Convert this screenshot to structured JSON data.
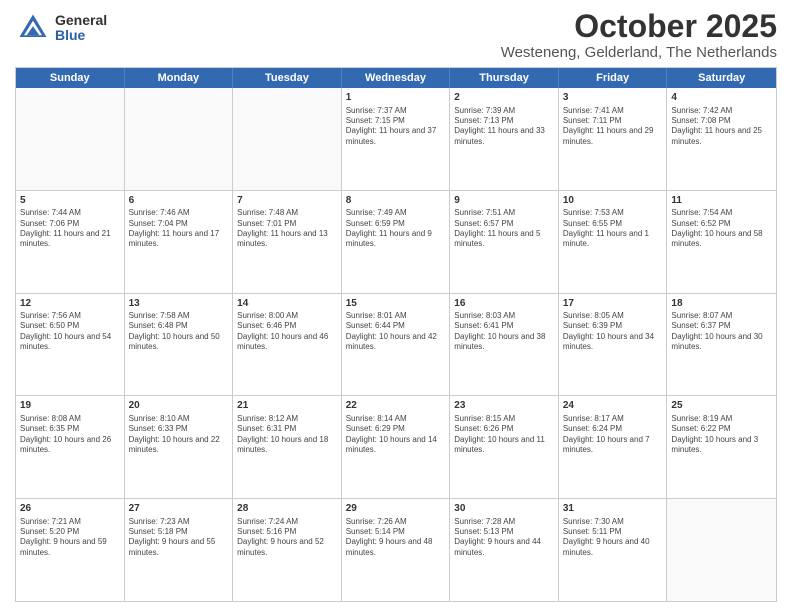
{
  "logo": {
    "general": "General",
    "blue": "Blue"
  },
  "title": "October 2025",
  "location": "Westeneng, Gelderland, The Netherlands",
  "days": [
    "Sunday",
    "Monday",
    "Tuesday",
    "Wednesday",
    "Thursday",
    "Friday",
    "Saturday"
  ],
  "weeks": [
    [
      {
        "day": "",
        "sunrise": "",
        "sunset": "",
        "daylight": ""
      },
      {
        "day": "",
        "sunrise": "",
        "sunset": "",
        "daylight": ""
      },
      {
        "day": "",
        "sunrise": "",
        "sunset": "",
        "daylight": ""
      },
      {
        "day": "1",
        "sunrise": "Sunrise: 7:37 AM",
        "sunset": "Sunset: 7:15 PM",
        "daylight": "Daylight: 11 hours and 37 minutes."
      },
      {
        "day": "2",
        "sunrise": "Sunrise: 7:39 AM",
        "sunset": "Sunset: 7:13 PM",
        "daylight": "Daylight: 11 hours and 33 minutes."
      },
      {
        "day": "3",
        "sunrise": "Sunrise: 7:41 AM",
        "sunset": "Sunset: 7:11 PM",
        "daylight": "Daylight: 11 hours and 29 minutes."
      },
      {
        "day": "4",
        "sunrise": "Sunrise: 7:42 AM",
        "sunset": "Sunset: 7:08 PM",
        "daylight": "Daylight: 11 hours and 25 minutes."
      }
    ],
    [
      {
        "day": "5",
        "sunrise": "Sunrise: 7:44 AM",
        "sunset": "Sunset: 7:06 PM",
        "daylight": "Daylight: 11 hours and 21 minutes."
      },
      {
        "day": "6",
        "sunrise": "Sunrise: 7:46 AM",
        "sunset": "Sunset: 7:04 PM",
        "daylight": "Daylight: 11 hours and 17 minutes."
      },
      {
        "day": "7",
        "sunrise": "Sunrise: 7:48 AM",
        "sunset": "Sunset: 7:01 PM",
        "daylight": "Daylight: 11 hours and 13 minutes."
      },
      {
        "day": "8",
        "sunrise": "Sunrise: 7:49 AM",
        "sunset": "Sunset: 6:59 PM",
        "daylight": "Daylight: 11 hours and 9 minutes."
      },
      {
        "day": "9",
        "sunrise": "Sunrise: 7:51 AM",
        "sunset": "Sunset: 6:57 PM",
        "daylight": "Daylight: 11 hours and 5 minutes."
      },
      {
        "day": "10",
        "sunrise": "Sunrise: 7:53 AM",
        "sunset": "Sunset: 6:55 PM",
        "daylight": "Daylight: 11 hours and 1 minute."
      },
      {
        "day": "11",
        "sunrise": "Sunrise: 7:54 AM",
        "sunset": "Sunset: 6:52 PM",
        "daylight": "Daylight: 10 hours and 58 minutes."
      }
    ],
    [
      {
        "day": "12",
        "sunrise": "Sunrise: 7:56 AM",
        "sunset": "Sunset: 6:50 PM",
        "daylight": "Daylight: 10 hours and 54 minutes."
      },
      {
        "day": "13",
        "sunrise": "Sunrise: 7:58 AM",
        "sunset": "Sunset: 6:48 PM",
        "daylight": "Daylight: 10 hours and 50 minutes."
      },
      {
        "day": "14",
        "sunrise": "Sunrise: 8:00 AM",
        "sunset": "Sunset: 6:46 PM",
        "daylight": "Daylight: 10 hours and 46 minutes."
      },
      {
        "day": "15",
        "sunrise": "Sunrise: 8:01 AM",
        "sunset": "Sunset: 6:44 PM",
        "daylight": "Daylight: 10 hours and 42 minutes."
      },
      {
        "day": "16",
        "sunrise": "Sunrise: 8:03 AM",
        "sunset": "Sunset: 6:41 PM",
        "daylight": "Daylight: 10 hours and 38 minutes."
      },
      {
        "day": "17",
        "sunrise": "Sunrise: 8:05 AM",
        "sunset": "Sunset: 6:39 PM",
        "daylight": "Daylight: 10 hours and 34 minutes."
      },
      {
        "day": "18",
        "sunrise": "Sunrise: 8:07 AM",
        "sunset": "Sunset: 6:37 PM",
        "daylight": "Daylight: 10 hours and 30 minutes."
      }
    ],
    [
      {
        "day": "19",
        "sunrise": "Sunrise: 8:08 AM",
        "sunset": "Sunset: 6:35 PM",
        "daylight": "Daylight: 10 hours and 26 minutes."
      },
      {
        "day": "20",
        "sunrise": "Sunrise: 8:10 AM",
        "sunset": "Sunset: 6:33 PM",
        "daylight": "Daylight: 10 hours and 22 minutes."
      },
      {
        "day": "21",
        "sunrise": "Sunrise: 8:12 AM",
        "sunset": "Sunset: 6:31 PM",
        "daylight": "Daylight: 10 hours and 18 minutes."
      },
      {
        "day": "22",
        "sunrise": "Sunrise: 8:14 AM",
        "sunset": "Sunset: 6:29 PM",
        "daylight": "Daylight: 10 hours and 14 minutes."
      },
      {
        "day": "23",
        "sunrise": "Sunrise: 8:15 AM",
        "sunset": "Sunset: 6:26 PM",
        "daylight": "Daylight: 10 hours and 11 minutes."
      },
      {
        "day": "24",
        "sunrise": "Sunrise: 8:17 AM",
        "sunset": "Sunset: 6:24 PM",
        "daylight": "Daylight: 10 hours and 7 minutes."
      },
      {
        "day": "25",
        "sunrise": "Sunrise: 8:19 AM",
        "sunset": "Sunset: 6:22 PM",
        "daylight": "Daylight: 10 hours and 3 minutes."
      }
    ],
    [
      {
        "day": "26",
        "sunrise": "Sunrise: 7:21 AM",
        "sunset": "Sunset: 5:20 PM",
        "daylight": "Daylight: 9 hours and 59 minutes."
      },
      {
        "day": "27",
        "sunrise": "Sunrise: 7:23 AM",
        "sunset": "Sunset: 5:18 PM",
        "daylight": "Daylight: 9 hours and 55 minutes."
      },
      {
        "day": "28",
        "sunrise": "Sunrise: 7:24 AM",
        "sunset": "Sunset: 5:16 PM",
        "daylight": "Daylight: 9 hours and 52 minutes."
      },
      {
        "day": "29",
        "sunrise": "Sunrise: 7:26 AM",
        "sunset": "Sunset: 5:14 PM",
        "daylight": "Daylight: 9 hours and 48 minutes."
      },
      {
        "day": "30",
        "sunrise": "Sunrise: 7:28 AM",
        "sunset": "Sunset: 5:13 PM",
        "daylight": "Daylight: 9 hours and 44 minutes."
      },
      {
        "day": "31",
        "sunrise": "Sunrise: 7:30 AM",
        "sunset": "Sunset: 5:11 PM",
        "daylight": "Daylight: 9 hours and 40 minutes."
      },
      {
        "day": "",
        "sunrise": "",
        "sunset": "",
        "daylight": ""
      }
    ]
  ]
}
